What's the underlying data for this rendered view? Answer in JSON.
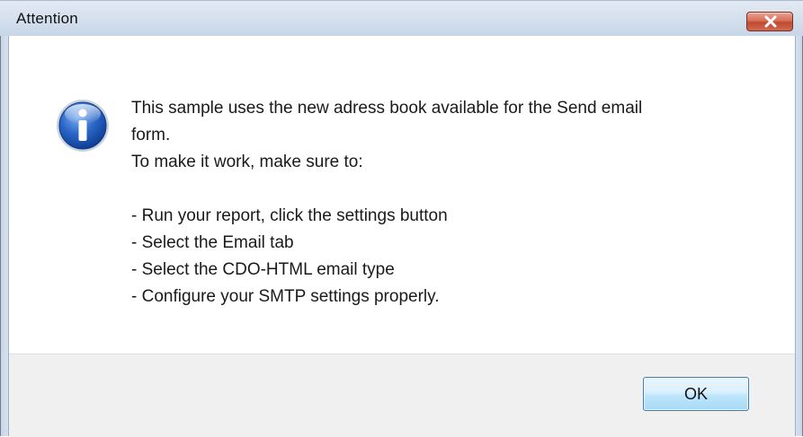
{
  "dialog": {
    "title": "Attention",
    "icon": "info-icon",
    "message_lines": [
      "This sample uses the new adress book available for the Send email",
      "form.",
      "To make it work, make sure to:",
      "",
      "- Run your report, click the settings button",
      "- Select the Email tab",
      "- Select the CDO-HTML email type",
      "- Configure your SMTP settings properly."
    ],
    "ok_label": "OK"
  },
  "colors": {
    "titlebar": "#d6e1ee",
    "close_button": "#c14a32",
    "footer": "#f0f0f0",
    "ok_border": "#3c7fb1"
  }
}
